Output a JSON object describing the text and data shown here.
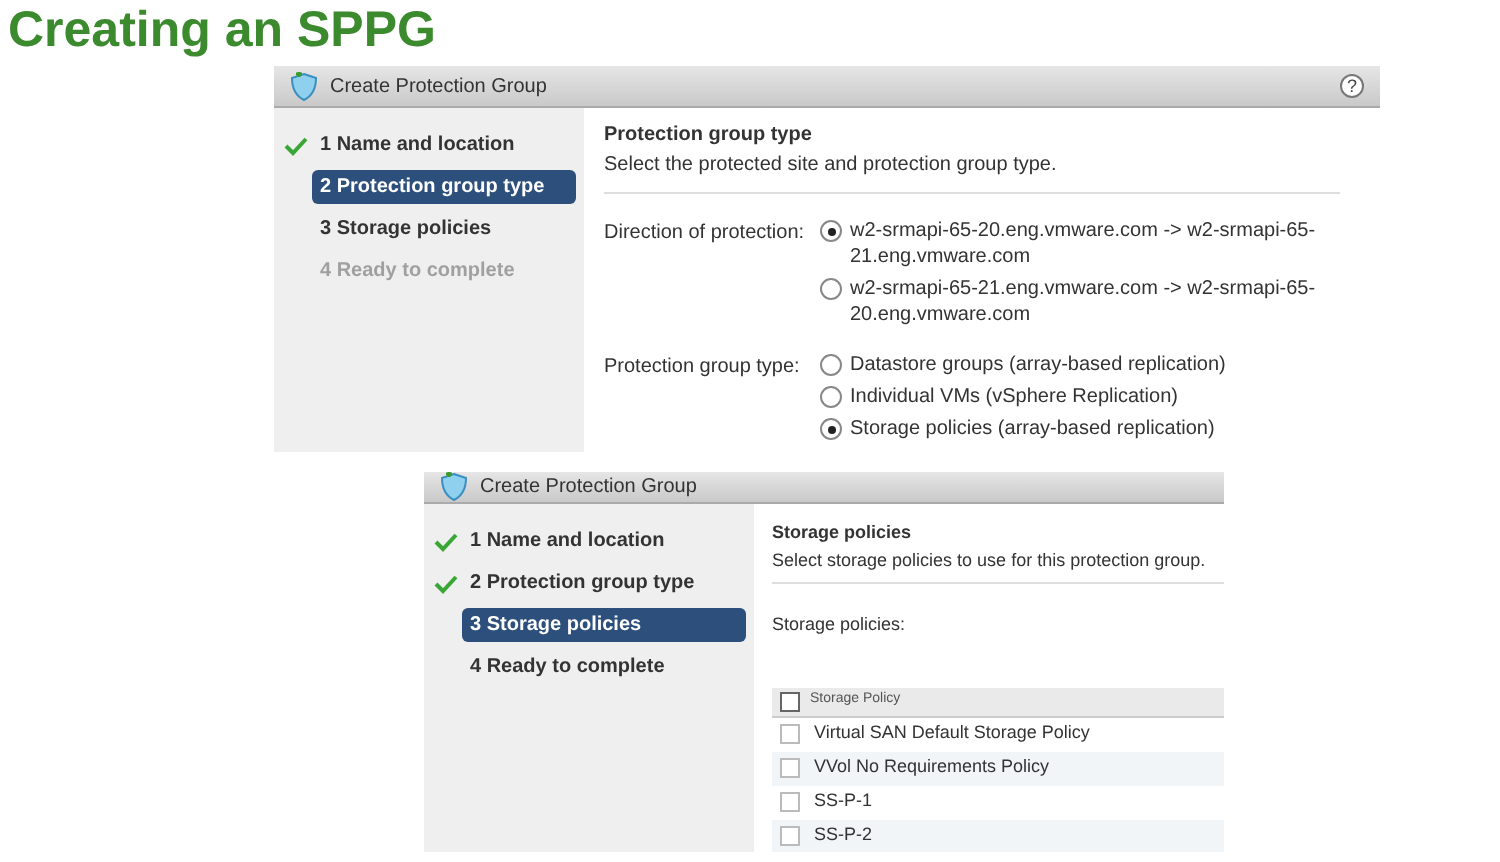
{
  "slide_title": "Creating an SPPG",
  "dialogs": [
    {
      "kind": "type",
      "title": "Create Protection Group",
      "help": "?",
      "steps": [
        {
          "label": "1 Name and location",
          "checked": true,
          "selected": false,
          "disabled": false
        },
        {
          "label": "2 Protection group type",
          "checked": false,
          "selected": true,
          "disabled": false
        },
        {
          "label": "3 Storage policies",
          "checked": false,
          "selected": false,
          "disabled": false
        },
        {
          "label": "4 Ready to complete",
          "checked": false,
          "selected": false,
          "disabled": true
        }
      ],
      "heading": "Protection group type",
      "subheading": "Select the protected site and protection group type.",
      "fields": [
        {
          "label": "Direction of protection:",
          "options": [
            {
              "label": "w2-srmapi-65-20.eng.vmware.com -> w2-srmapi-65-21.eng.vmware.com",
              "selected": true
            },
            {
              "label": "w2-srmapi-65-21.eng.vmware.com -> w2-srmapi-65-20.eng.vmware.com",
              "selected": false
            }
          ]
        },
        {
          "label": "Protection group type:",
          "options": [
            {
              "label": "Datastore groups (array-based replication)",
              "selected": false
            },
            {
              "label": "Individual VMs (vSphere Replication)",
              "selected": false
            },
            {
              "label": "Storage policies (array-based replication)",
              "selected": true
            }
          ]
        }
      ]
    },
    {
      "kind": "policies",
      "title": "Create Protection Group",
      "steps": [
        {
          "label": "1 Name and location",
          "checked": true,
          "selected": false,
          "disabled": false
        },
        {
          "label": "2 Protection group type",
          "checked": true,
          "selected": false,
          "disabled": false
        },
        {
          "label": "3 Storage policies",
          "checked": false,
          "selected": true,
          "disabled": false
        },
        {
          "label": "4 Ready to complete",
          "checked": false,
          "selected": false,
          "disabled": false
        }
      ],
      "heading": "Storage policies",
      "subheading": "Select storage policies to use for this protection group.",
      "list_label": "Storage policies:",
      "table": {
        "header": {
          "label": "Storage Policy",
          "checked": false
        },
        "rows": [
          {
            "label": "Virtual SAN Default Storage Policy",
            "checked": false
          },
          {
            "label": "VVol No Requirements Policy",
            "checked": false
          },
          {
            "label": "SS-P-1",
            "checked": false
          },
          {
            "label": "SS-P-2",
            "checked": false
          }
        ]
      }
    }
  ]
}
